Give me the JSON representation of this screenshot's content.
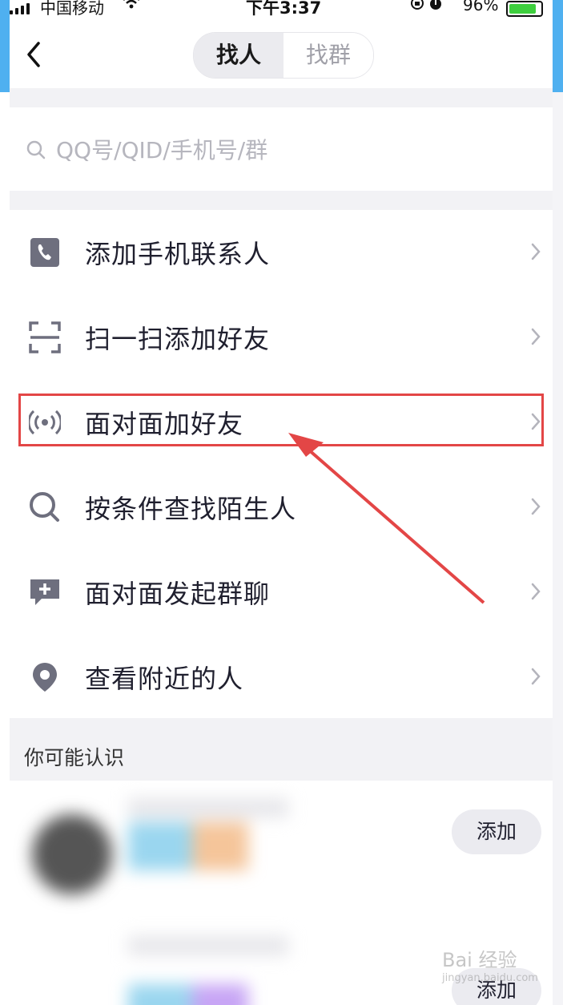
{
  "status_bar": {
    "carrier": "中国移动",
    "time": "下午3:37",
    "battery_percent": "96%",
    "battery_level": 0.96
  },
  "header": {
    "tabs": [
      {
        "label": "找人",
        "selected": true
      },
      {
        "label": "找群",
        "selected": false
      }
    ]
  },
  "search": {
    "placeholder": "QQ号/QID/手机号/群"
  },
  "menu": {
    "items": [
      {
        "label": "添加手机联系人",
        "icon": "phone-icon"
      },
      {
        "label": "扫一扫添加好友",
        "icon": "scan-icon"
      },
      {
        "label": "面对面加好友",
        "icon": "radar-signal-icon"
      },
      {
        "label": "按条件查找陌生人",
        "icon": "search-icon"
      },
      {
        "label": "面对面发起群聊",
        "icon": "chat-add-icon"
      },
      {
        "label": "查看附近的人",
        "icon": "location-pin-icon"
      }
    ]
  },
  "suggestions": {
    "title": "你可能认识",
    "items": [
      {
        "button_label": "添加"
      },
      {
        "button_label": "添加"
      }
    ]
  },
  "watermark": {
    "text": "Bai 经验",
    "subtext": "jingyan.baidu.com"
  },
  "colors": {
    "highlight": "#e34646",
    "icon_gray": "#6e6f7e",
    "battery": "#3ecf3e"
  }
}
